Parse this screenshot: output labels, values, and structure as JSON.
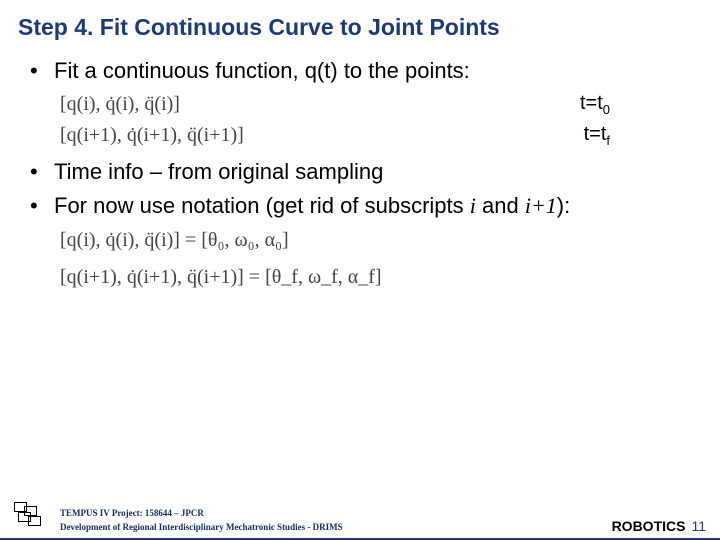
{
  "title": "Step 4. Fit Continuous Curve to Joint Points",
  "bullets": {
    "b1": "Fit a continuous function, q(t) to the points:",
    "b2": "Time info – from original sampling",
    "b3_pre": "For now use notation (get rid of subscripts ",
    "b3_i": "i",
    "b3_and": " and ",
    "b3_i1": "i+1",
    "b3_post": "):"
  },
  "equations": {
    "row1": "[q(i), q̇(i), q̈(i)]",
    "row1_time_pre": "t=t",
    "row1_time_sub": "0",
    "row2": "[q(i+1), q̇(i+1), q̈(i+1)]",
    "row2_time_pre": "t=t",
    "row2_time_sub": "f",
    "eq3": "[q(i), q̇(i), q̈(i)] = [θ₀, ω₀, α₀]",
    "eq4": "[q(i+1), q̇(i+1), q̈(i+1)] = [θ_f, ω_f, α_f]"
  },
  "footer": {
    "line1": "TEMPUS IV Project: 158644 – JPCR",
    "line2": "Development of Regional Interdisciplinary Mechatronic Studies - DRIMS",
    "course": "ROBOTICS",
    "page": "11"
  }
}
